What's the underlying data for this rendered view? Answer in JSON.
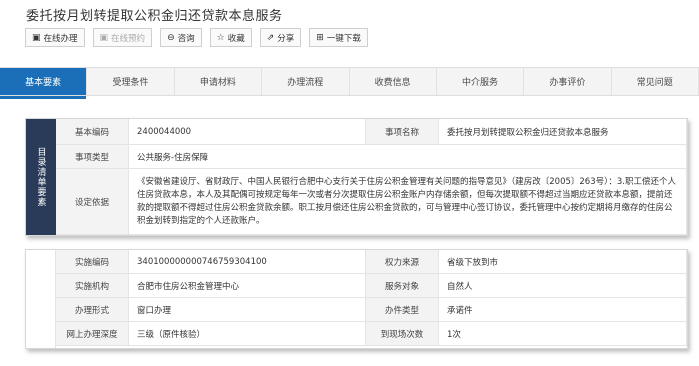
{
  "page": {
    "title": "委托按月划转提取公积金归还贷款本息服务"
  },
  "actions": [
    {
      "icon": "▣",
      "label": "在线办理",
      "enabled": true
    },
    {
      "icon": "▣",
      "label": "在线预约",
      "enabled": false
    },
    {
      "icon": "⊖",
      "label": "咨询",
      "enabled": true
    },
    {
      "icon": "☆",
      "label": "收藏",
      "enabled": true
    },
    {
      "icon": "⇗",
      "label": "分享",
      "enabled": true
    },
    {
      "icon": "⊞",
      "label": "一键下载",
      "enabled": true
    }
  ],
  "tabs": [
    "基本要素",
    "受理条件",
    "申请材料",
    "办理流程",
    "收费信息",
    "中介服务",
    "办事评价",
    "常见问题"
  ],
  "section1": {
    "side_label": "目录清单要素",
    "rows": {
      "code_label": "基本编码",
      "code_value": "2400044000",
      "name_label": "事项名称",
      "name_value": "委托按月划转提取公积金归还贷款本息服务",
      "type_label": "事项类型",
      "type_value": "公共服务-住房保障",
      "basis_label": "设定依据",
      "basis_value": "《安徽省建设厅、省财政厅、中国人民银行合肥中心支行关于住房公积金管理有关问题的指导意见》（建房改〔2005〕263号）：3.职工偿还个人住房贷款本息，本人及其配偶可按规定每年一次或者分次提取住房公积金账户内存储余额，但每次提取额不得超过当期应还贷款本息额，提前还款的提取额不得超过住房公积金贷款余额。职工按月偿还住房公积金贷款的，可与管理中心签订协议，委托管理中心按约定期将月缴存的住房公积金划转到指定的个人还款账户。"
    }
  },
  "section2": {
    "rows": [
      {
        "l1": "实施编码",
        "v1": "340100000000746759304100",
        "l2": "权力来源",
        "v2": "省级下放到市"
      },
      {
        "l1": "实施机构",
        "v1": "合肥市住房公积金管理中心",
        "l2": "服务对象",
        "v2": "自然人"
      },
      {
        "l1": "办理形式",
        "v1": "窗口办理",
        "l2": "办件类型",
        "v2": "承诺件"
      },
      {
        "l1": "网上办理深度",
        "v1": "三级（原件核验）",
        "l2": "到现场次数",
        "v2": "1次"
      }
    ]
  }
}
